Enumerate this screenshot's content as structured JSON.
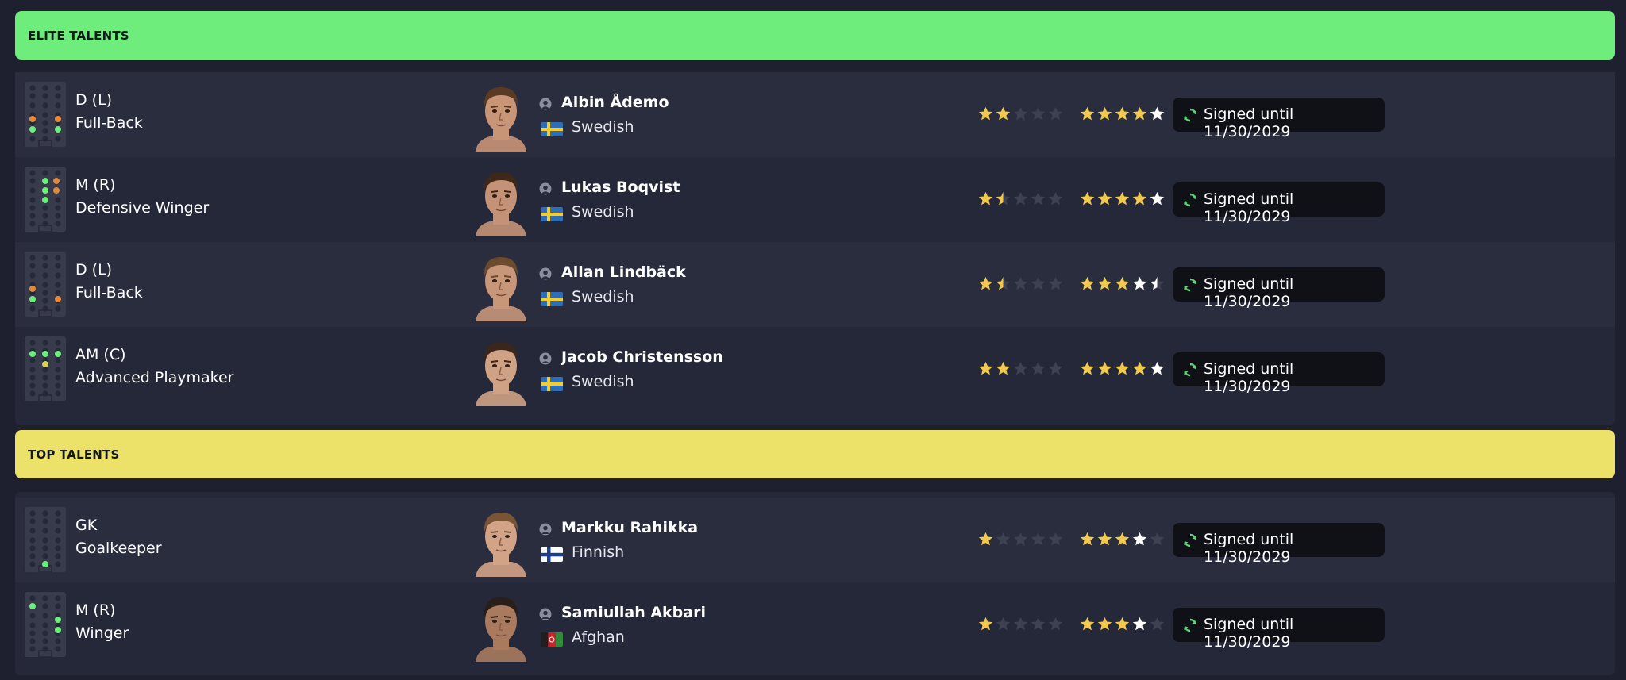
{
  "sections": [
    {
      "title": "ELITE TALENTS",
      "color": "#6eec7c",
      "players": [
        {
          "position": "D (L)",
          "role": "Full-Back",
          "name": "Albin Ådemo",
          "nationality": "Swedish",
          "flag": "sweden",
          "current_ability_stars": 2,
          "potential_ability_stars": 5,
          "contract": "Signed until 11/30/2029",
          "skin": "#c99577",
          "hair": "#5a3a23"
        },
        {
          "position": "M (R)",
          "role": "Defensive Winger",
          "name": "Lukas Boqvist",
          "nationality": "Swedish",
          "flag": "sweden",
          "current_ability_stars": 1.5,
          "potential_ability_stars": 5,
          "contract": "Signed until 11/30/2029",
          "skin": "#c49377",
          "hair": "#3e2818"
        },
        {
          "position": "D (L)",
          "role": "Full-Back",
          "name": "Allan Lindbäck",
          "nationality": "Swedish",
          "flag": "sweden",
          "current_ability_stars": 1.5,
          "potential_ability_stars": 4.5,
          "contract": "Signed until 11/30/2029",
          "skin": "#c8977a",
          "hair": "#6b4a2e"
        },
        {
          "position": "AM (C)",
          "role": "Advanced Playmaker",
          "name": "Jacob Christensson",
          "nationality": "Swedish",
          "flag": "sweden",
          "current_ability_stars": 2,
          "potential_ability_stars": 5,
          "contract": "Signed until 11/30/2029",
          "skin": "#cfa286",
          "hair": "#3a261a"
        }
      ]
    },
    {
      "title": "TOP TALENTS",
      "color": "#ece26a",
      "players": [
        {
          "position": "GK",
          "role": "Goalkeeper",
          "name": "Markku Rahikka",
          "nationality": "Finnish",
          "flag": "finland",
          "current_ability_stars": 1,
          "potential_ability_stars": 4,
          "contract": "Signed until 11/30/2029",
          "skin": "#d2a387",
          "hair": "#7a5535"
        },
        {
          "position": "M (R)",
          "role": "Winger",
          "name": "Samiullah Akbari",
          "nationality": "Afghan",
          "flag": "afghanistan",
          "current_ability_stars": 1,
          "potential_ability_stars": 4,
          "contract": "Signed until 11/30/2029",
          "skin": "#a97a5e",
          "hair": "#2a1f18"
        }
      ]
    }
  ],
  "colors": {
    "star_gold": "#f2c94c",
    "star_white": "#ffffff",
    "star_empty": "#3e4152",
    "renew_green": "#5fd37a",
    "dot_green": "#6bef7a",
    "dot_orange": "#e38a3a",
    "dot_yellow": "#d6d35a"
  }
}
